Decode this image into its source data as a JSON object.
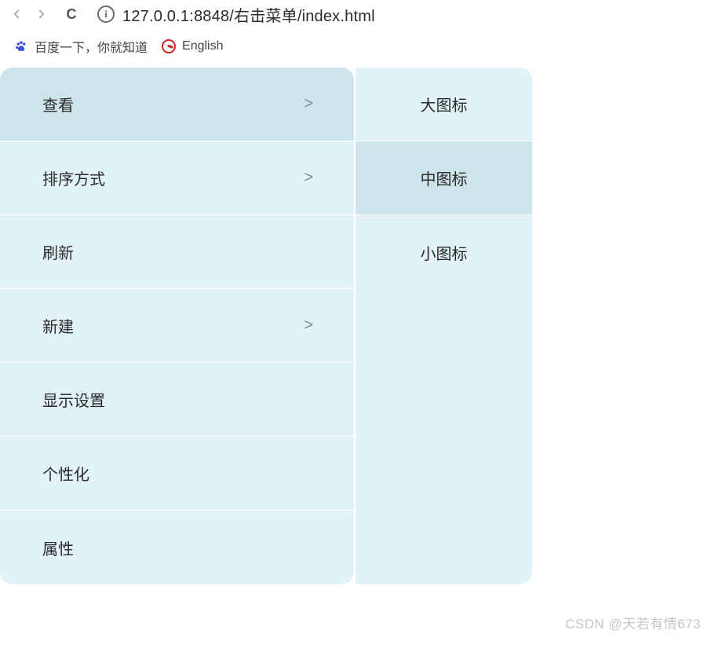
{
  "browser": {
    "url": "127.0.0.1:8848/右击菜单/index.html"
  },
  "bookmarks": {
    "baidu": "百度一下，你就知道",
    "english": "English"
  },
  "menu": {
    "items": [
      {
        "label": "查看",
        "arrow": ">",
        "hovered": true
      },
      {
        "label": "排序方式",
        "arrow": ">",
        "hovered": false
      },
      {
        "label": "刷新",
        "arrow": "",
        "hovered": false
      },
      {
        "label": "新建",
        "arrow": ">",
        "hovered": false
      },
      {
        "label": "显示设置",
        "arrow": "",
        "hovered": false
      },
      {
        "label": "个性化",
        "arrow": "",
        "hovered": false
      },
      {
        "label": "属性",
        "arrow": "",
        "hovered": false
      }
    ],
    "submenu": [
      {
        "label": "大图标",
        "hovered": false
      },
      {
        "label": "中图标",
        "hovered": true
      },
      {
        "label": "小图标",
        "hovered": false
      }
    ]
  },
  "watermark": "CSDN @天若有情673"
}
